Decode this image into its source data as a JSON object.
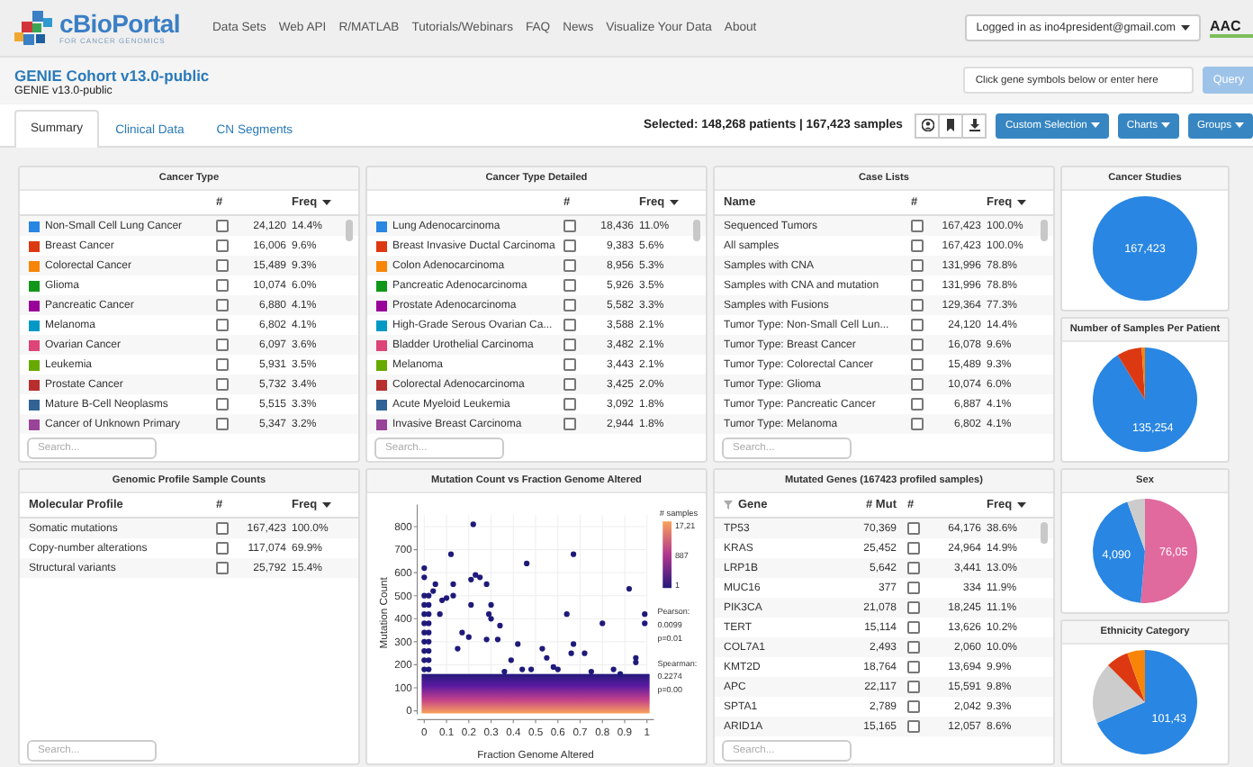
{
  "navbar": {
    "logo_title": "cBioPortal",
    "logo_subtitle": "FOR CANCER GENOMICS",
    "links": [
      "Data Sets",
      "Web API",
      "R/MATLAB",
      "Tutorials/Webinars",
      "FAQ",
      "News",
      "Visualize Your Data",
      "About"
    ],
    "user_menu": "Logged in as ino4president@gmail.com",
    "partner_logo": "AAC"
  },
  "study": {
    "title": "GENIE Cohort v13.0-public",
    "subtitle": "GENIE v13.0-public"
  },
  "gene_query": {
    "placeholder": "Click gene symbols below or enter here",
    "button": "Query"
  },
  "tabs": [
    {
      "label": "Summary",
      "selected": true
    },
    {
      "label": "Clinical Data",
      "selected": false
    },
    {
      "label": "CN Segments",
      "selected": false
    }
  ],
  "selection_summary": "Selected: 148,268 patients | 167,423 samples",
  "toolbar_buttons": [
    "Custom Selection",
    "Charts",
    "Groups"
  ],
  "cards": [
    {
      "kind": "table",
      "title": "Cancer Type",
      "placeholder": "Search...",
      "columns": [
        {
          "label": "#",
          "kind": "count",
          "sorted": false
        },
        {
          "label": "Freq",
          "kind": "freq",
          "sorted": true
        }
      ],
      "rows": [
        {
          "name": "Non-Small Cell Lung Cancer",
          "color": "#2986e2",
          "count": "24,120",
          "freq": "14.4%",
          "checked": false
        },
        {
          "name": "Breast Cancer",
          "color": "#dc3912",
          "count": "16,006",
          "freq": "9.6%",
          "checked": false
        },
        {
          "name": "Colorectal Cancer",
          "color": "#f88508",
          "count": "15,489",
          "freq": "9.3%",
          "checked": false
        },
        {
          "name": "Glioma",
          "color": "#109618",
          "count": "10,074",
          "freq": "6.0%",
          "checked": false
        },
        {
          "name": "Pancreatic Cancer",
          "color": "#990099",
          "count": "6,880",
          "freq": "4.1%",
          "checked": false
        },
        {
          "name": "Melanoma",
          "color": "#0099c6",
          "count": "6,802",
          "freq": "4.1%",
          "checked": false
        },
        {
          "name": "Ovarian Cancer",
          "color": "#dd4477",
          "count": "6,097",
          "freq": "3.6%",
          "checked": false
        },
        {
          "name": "Leukemia",
          "color": "#66aa00",
          "count": "5,931",
          "freq": "3.5%",
          "checked": false
        },
        {
          "name": "Prostate Cancer",
          "color": "#b82e2e",
          "count": "5,732",
          "freq": "3.4%",
          "checked": false
        },
        {
          "name": "Mature B-Cell Neoplasms",
          "color": "#316395",
          "count": "5,515",
          "freq": "3.3%",
          "checked": false
        },
        {
          "name": "Cancer of Unknown Primary",
          "color": "#994499",
          "count": "5,347",
          "freq": "3.2%",
          "checked": false
        }
      ]
    },
    {
      "kind": "table",
      "title": "Cancer Type Detailed",
      "placeholder": "Search...",
      "columns": [
        {
          "label": "#",
          "kind": "count",
          "sorted": false
        },
        {
          "label": "Freq",
          "kind": "freq",
          "sorted": true
        }
      ],
      "rows": [
        {
          "name": "Lung Adenocarcinoma",
          "color": "#2986e2",
          "count": "18,436",
          "freq": "11.0%",
          "checked": false
        },
        {
          "name": "Breast Invasive Ductal Carcinoma",
          "color": "#dc3912",
          "count": "9,383",
          "freq": "5.6%",
          "checked": false
        },
        {
          "name": "Colon Adenocarcinoma",
          "color": "#f88508",
          "count": "8,956",
          "freq": "5.3%",
          "checked": false
        },
        {
          "name": "Pancreatic Adenocarcinoma",
          "color": "#109618",
          "count": "5,926",
          "freq": "3.5%",
          "checked": false
        },
        {
          "name": "Prostate Adenocarcinoma",
          "color": "#990099",
          "count": "5,582",
          "freq": "3.3%",
          "checked": false
        },
        {
          "name": "High-Grade Serous Ovarian Ca...",
          "color": "#0099c6",
          "count": "3,588",
          "freq": "2.1%",
          "checked": false
        },
        {
          "name": "Bladder Urothelial Carcinoma",
          "color": "#dd4477",
          "count": "3,482",
          "freq": "2.1%",
          "checked": false
        },
        {
          "name": "Melanoma",
          "color": "#66aa00",
          "count": "3,443",
          "freq": "2.1%",
          "checked": false
        },
        {
          "name": "Colorectal Adenocarcinoma",
          "color": "#b82e2e",
          "count": "3,425",
          "freq": "2.0%",
          "checked": false
        },
        {
          "name": "Acute Myeloid Leukemia",
          "color": "#316395",
          "count": "3,092",
          "freq": "1.8%",
          "checked": false
        },
        {
          "name": "Invasive Breast Carcinoma",
          "color": "#994499",
          "count": "2,944",
          "freq": "1.8%",
          "checked": false
        }
      ]
    },
    {
      "kind": "table",
      "title": "Case Lists",
      "placeholder": "Search...",
      "columns": [
        {
          "label": "Name",
          "kind": "name",
          "sorted": false
        },
        {
          "label": "#",
          "kind": "count",
          "sorted": false
        },
        {
          "label": "Freq",
          "kind": "freq",
          "sorted": true
        }
      ],
      "rows": [
        {
          "name": "Sequenced Tumors",
          "count": "167,423",
          "freq": "100.0%",
          "checked": false
        },
        {
          "name": "All samples",
          "count": "167,423",
          "freq": "100.0%",
          "checked": false
        },
        {
          "name": "Samples with CNA",
          "count": "131,996",
          "freq": "78.8%",
          "checked": false
        },
        {
          "name": "Samples with CNA and mutation",
          "count": "131,996",
          "freq": "78.8%",
          "checked": false
        },
        {
          "name": "Samples with Fusions",
          "count": "129,364",
          "freq": "77.3%",
          "checked": false
        },
        {
          "name": "Tumor Type: Non-Small Cell Lun...",
          "count": "24,120",
          "freq": "14.4%",
          "checked": false
        },
        {
          "name": "Tumor Type: Breast Cancer",
          "count": "16,078",
          "freq": "9.6%",
          "checked": false
        },
        {
          "name": "Tumor Type: Colorectal Cancer",
          "count": "15,489",
          "freq": "9.3%",
          "checked": false
        },
        {
          "name": "Tumor Type: Glioma",
          "count": "10,074",
          "freq": "6.0%",
          "checked": false
        },
        {
          "name": "Tumor Type: Pancreatic Cancer",
          "count": "6,887",
          "freq": "4.1%",
          "checked": false
        },
        {
          "name": "Tumor Type: Melanoma",
          "count": "6,802",
          "freq": "4.1%",
          "checked": false
        }
      ]
    },
    {
      "kind": "pie",
      "title": "Cancer Studies",
      "chart_data": {
        "type": "pie",
        "values": [
          167423
        ],
        "colors": [
          "#2986e2"
        ],
        "value_labels": [
          "167,423"
        ]
      }
    },
    {
      "kind": "pie",
      "title": "Number of Samples Per Patient",
      "chart_data": {
        "type": "pie",
        "values": [
          135254,
          11500,
          1514
        ],
        "colors": [
          "#2986e2",
          "#dc3912",
          "#f88508"
        ],
        "value_labels": [
          "135,254",
          null,
          null
        ]
      }
    },
    {
      "kind": "table",
      "title": "Genomic Profile Sample Counts",
      "placeholder": "Search...",
      "columns": [
        {
          "label": "Molecular Profile",
          "kind": "name",
          "sorted": false
        },
        {
          "label": "#",
          "kind": "count",
          "sorted": false
        },
        {
          "label": "Freq",
          "kind": "freq",
          "sorted": true
        }
      ],
      "rows": [
        {
          "name": "Somatic mutations",
          "count": "167,423",
          "freq": "100.0%",
          "checked": false
        },
        {
          "name": "Copy-number alterations",
          "count": "117,074",
          "freq": "69.9%",
          "checked": false
        },
        {
          "name": "Structural variants",
          "count": "25,792",
          "freq": "15.4%",
          "checked": false
        }
      ]
    },
    {
      "kind": "scatter",
      "title": "Mutation Count vs Fraction Genome Altered",
      "legend": {
        "max": "17,21",
        "mid": "887",
        "min": "1"
      },
      "stats": [
        "Pearson:",
        "0.0099",
        "p=0.01",
        "Spearman:",
        "0.2274",
        "p=0.00"
      ],
      "chart_data": {
        "type": "scatter",
        "xlabel": "Fraction Genome Altered",
        "ylabel": "Mutation Count",
        "xlim": [
          0,
          1
        ],
        "ylim": [
          0,
          850
        ],
        "grid": true,
        "bands": [
          {
            "axis": "y",
            "from": 0,
            "to": 160
          }
        ],
        "xticks": [
          0,
          0.1,
          0.2,
          0.3,
          0.4,
          0.5,
          0.6,
          0.7,
          0.8,
          0.9,
          1
        ],
        "yticks": [
          0,
          100,
          200,
          300,
          400,
          500,
          600,
          700,
          800
        ],
        "x": [
          0,
          0,
          0,
          0,
          0,
          0,
          0,
          0,
          0,
          0.02,
          0.02,
          0.02,
          0.02,
          0.02,
          0.02,
          0.02,
          0.02,
          0.02,
          0.22,
          0.12,
          0.46,
          0.67,
          0.92,
          0.99,
          0.99,
          0.8,
          0.64,
          0.23,
          0.25,
          0.21,
          0.28,
          0.3,
          0.21,
          0.29,
          0.3,
          0.34,
          0.17,
          0.2,
          0.28,
          0.33,
          0.42,
          0.53,
          0.55,
          0.67,
          0.66,
          0.72,
          0.39,
          0.44,
          0.48,
          0.6,
          0.95,
          0.95,
          0.05,
          0.08,
          0.13,
          0.13,
          0.04,
          0,
          0,
          0.1,
          0.07,
          0.15,
          0.36,
          0.58,
          0.75,
          0.85,
          0.88
        ],
        "series": [
          {
            "name": "# samples",
            "color": "#1f1a7a",
            "values": [
              180,
              220,
              260,
              300,
              340,
              380,
              420,
              460,
              500,
              180,
              220,
              260,
              300,
              340,
              380,
              420,
              460,
              500,
              810,
              680,
              640,
              680,
              530,
              420,
              380,
              380,
              420,
              590,
              580,
              570,
              550,
              460,
              460,
              420,
              400,
              370,
              340,
              320,
              310,
              310,
              290,
              270,
              230,
              290,
              250,
              250,
              220,
              180,
              180,
              180,
              230,
              210,
              550,
              480,
              550,
              500,
              520,
              620,
              580,
              490,
              420,
              270,
              170,
              190,
              170,
              180,
              160
            ]
          }
        ]
      }
    },
    {
      "kind": "table",
      "title": "Mutated Genes (167423 profiled samples)",
      "placeholder": "Search...",
      "columns": [
        {
          "label": "Gene",
          "kind": "gene",
          "sorted": false
        },
        {
          "label": "# Mut",
          "kind": "mut",
          "sorted": false
        },
        {
          "label": "#",
          "kind": "count",
          "sorted": false
        },
        {
          "label": "Freq",
          "kind": "freq",
          "sorted": true
        }
      ],
      "rows": [
        {
          "name": "TP53",
          "mut": "70,369",
          "count": "64,176",
          "freq": "38.6%",
          "checked": false
        },
        {
          "name": "KRAS",
          "mut": "25,452",
          "count": "24,964",
          "freq": "14.9%",
          "checked": false
        },
        {
          "name": "LRP1B",
          "mut": "5,642",
          "count": "3,441",
          "freq": "13.0%",
          "checked": false
        },
        {
          "name": "MUC16",
          "mut": "377",
          "count": "334",
          "freq": "11.9%",
          "checked": false
        },
        {
          "name": "PIK3CA",
          "mut": "21,078",
          "count": "18,245",
          "freq": "11.1%",
          "checked": false
        },
        {
          "name": "TERT",
          "mut": "15,114",
          "count": "13,626",
          "freq": "10.2%",
          "checked": false
        },
        {
          "name": "COL7A1",
          "mut": "2,493",
          "count": "2,060",
          "freq": "10.0%",
          "checked": false
        },
        {
          "name": "KMT2D",
          "mut": "18,764",
          "count": "13,694",
          "freq": "9.9%",
          "checked": false
        },
        {
          "name": "APC",
          "mut": "22,117",
          "count": "15,591",
          "freq": "9.8%",
          "checked": false
        },
        {
          "name": "SPTA1",
          "mut": "2,789",
          "count": "2,042",
          "freq": "9.3%",
          "checked": false
        },
        {
          "name": "ARID1A",
          "mut": "15,165",
          "count": "12,057",
          "freq": "8.6%",
          "checked": false
        }
      ]
    },
    {
      "kind": "pie",
      "title": "Sex",
      "clipped_labels": [
        {
          "color": "#2986e2",
          "text": "4,090"
        },
        {
          "color": "#e0699e",
          "text": "76,05"
        }
      ],
      "chart_data": {
        "type": "pie",
        "values": [
          51.3,
          43.2,
          5.5
        ],
        "colors": [
          "#e0699e",
          "#2986e2",
          "#cccccc"
        ]
      }
    },
    {
      "kind": "pie",
      "title": "Ethnicity Category",
      "clipped_labels": [
        {
          "color": "#2986e2",
          "text": "101,43"
        }
      ],
      "chart_data": {
        "type": "pie",
        "values": [
          68.5,
          19.0,
          7.0,
          5.5
        ],
        "colors": [
          "#2986e2",
          "#cccccc",
          "#dc3912",
          "#f88508"
        ]
      }
    }
  ]
}
